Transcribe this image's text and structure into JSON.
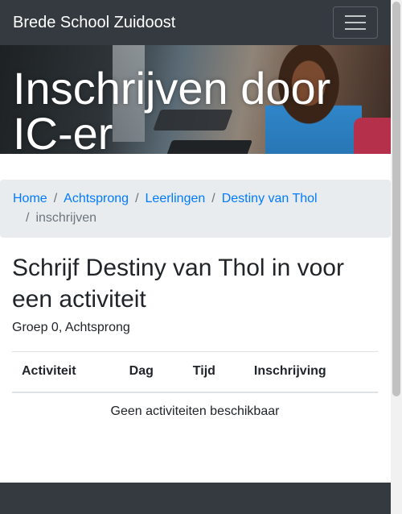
{
  "navbar": {
    "brand": "Brede School Zuidoost",
    "toggle_icon": "hamburger-menu-icon"
  },
  "hero": {
    "title": "Inschrijven door IC-er"
  },
  "breadcrumb": {
    "items": [
      "Home",
      "Achtsprong",
      "Leerlingen",
      "Destiny van Thol"
    ],
    "active": "inschrijven",
    "separator": "/"
  },
  "main": {
    "title": "Schrijf Destiny van Thol in voor een activiteit",
    "subtitle": "Groep 0, Achtsprong",
    "table": {
      "headers": [
        "Activiteit",
        "Dag",
        "Tijd",
        "Inschrijving"
      ],
      "empty_message": "Geen activiteiten beschikbaar"
    }
  },
  "colors": {
    "navbar_bg": "#343a40",
    "link": "#007bff",
    "breadcrumb_bg": "#e9ecef",
    "text": "#212529",
    "muted": "#6c757d"
  }
}
